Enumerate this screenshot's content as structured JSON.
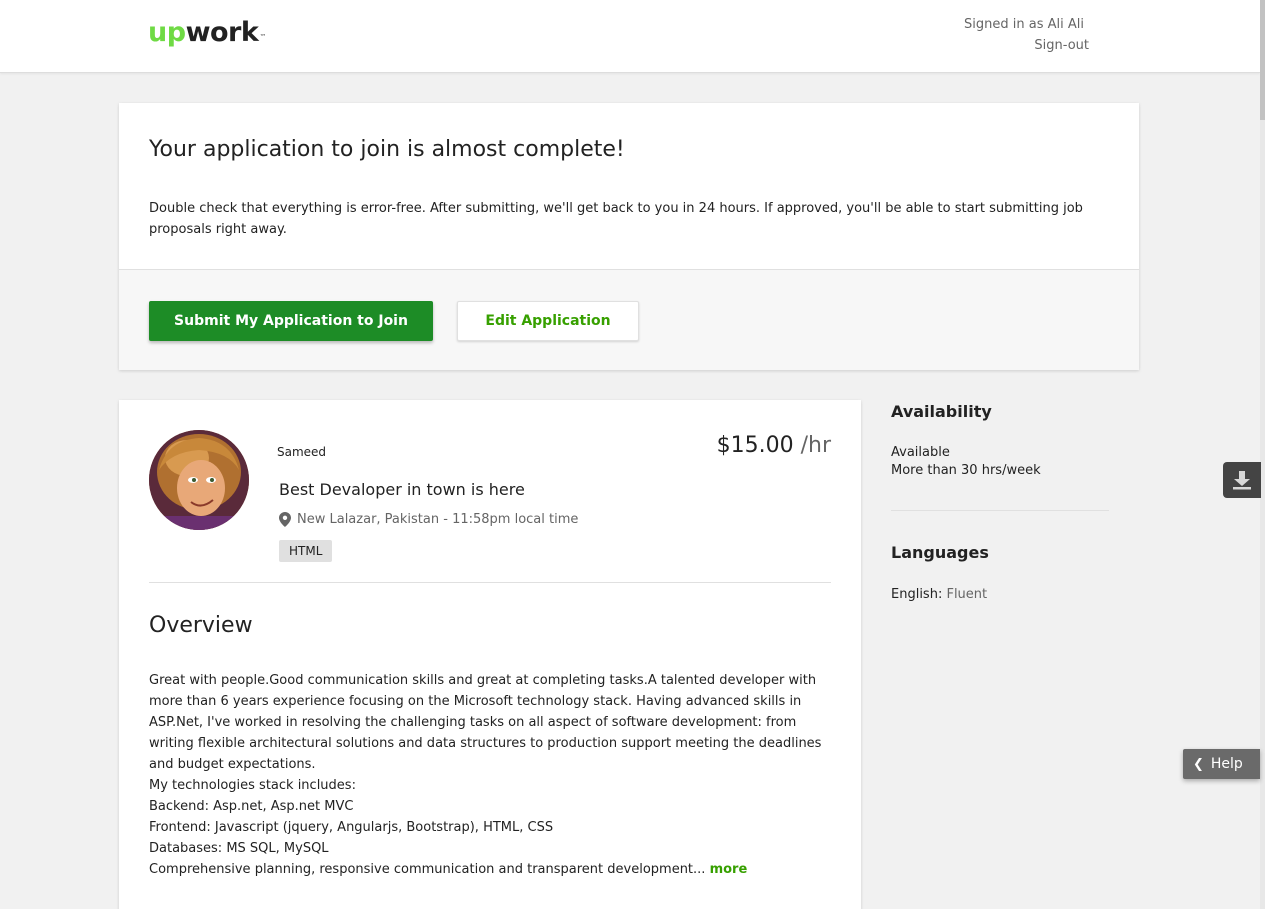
{
  "header": {
    "logo_up": "up",
    "logo_work": "work",
    "logo_tm": "™",
    "signed_in_text": "Signed in as Ali Ali",
    "sign_out_label": "Sign-out"
  },
  "application": {
    "title": "Your application to join is almost complete!",
    "description": "Double check that everything is error-free. After submitting, we'll get back to you in 24 hours. If approved, you'll be able to start submitting job proposals right away.",
    "submit_label": "Submit My Application to Join",
    "edit_label": "Edit Application"
  },
  "profile": {
    "name": "Sameed",
    "rate": "$15.00",
    "rate_unit": " /hr",
    "title": "Best Devaloper in town is here",
    "location": "New Lalazar, Pakistan - 11:58pm local time",
    "skills": [
      "HTML"
    ],
    "overview_heading": "Overview",
    "overview_lines": [
      "Great with people.Good communication skills and great at completing tasks.A talented developer with more than 6 years experience focusing on the Microsoft technology stack. Having advanced skills in ASP.Net, I've worked in resolving the challenging tasks on all aspect of software development: from writing flexible architectural solutions and data structures to production support meeting the deadlines and budget expectations.",
      "My technologies stack includes:",
      "Backend: Asp.net, Asp.net MVC",
      "Frontend: Javascript (jquery, Angularjs, Bootstrap), HTML, CSS",
      "Databases: MS SQL, MySQL",
      "Comprehensive planning, responsive communication and transparent development..."
    ],
    "more_label": "more"
  },
  "sidebar": {
    "availability_heading": "Availability",
    "availability_status": "Available",
    "availability_hours": "More than 30 hrs/week",
    "languages_heading": "Languages",
    "language_name": "English:",
    "language_level": " Fluent"
  },
  "widgets": {
    "help_label": "Help"
  },
  "colors": {
    "brand_green": "#6fda44",
    "primary_button": "#1d8c26",
    "link_green": "#37a000"
  }
}
